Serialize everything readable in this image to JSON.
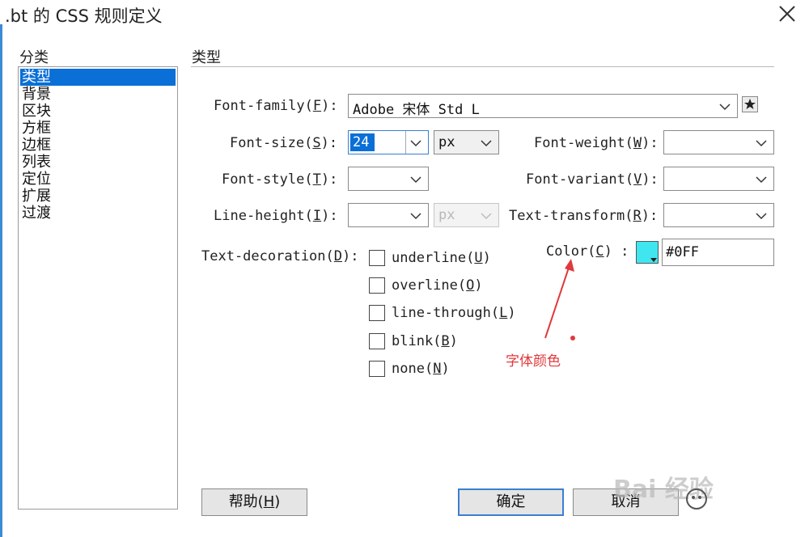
{
  "window": {
    "title": ".bt 的 CSS 规则定义"
  },
  "sidebar": {
    "header": "分类",
    "items": [
      {
        "label": "类型",
        "selected": true
      },
      {
        "label": "背景",
        "selected": false
      },
      {
        "label": "区块",
        "selected": false
      },
      {
        "label": "方框",
        "selected": false
      },
      {
        "label": "边框",
        "selected": false
      },
      {
        "label": "列表",
        "selected": false
      },
      {
        "label": "定位",
        "selected": false
      },
      {
        "label": "扩展",
        "selected": false
      },
      {
        "label": "过渡",
        "selected": false
      }
    ]
  },
  "panel": {
    "header": "类型",
    "font_family": {
      "label_pre": "Font-family(",
      "key": "F",
      "label_post": "):",
      "value": "Adobe 宋体 Std L",
      "icon": "star-icon"
    },
    "font_size": {
      "label_pre": "Font-size(",
      "key": "S",
      "label_post": "):",
      "value": "24",
      "unit": "px"
    },
    "font_weight": {
      "label_pre": "Font-weight(",
      "key": "W",
      "label_post": "):",
      "value": ""
    },
    "font_style": {
      "label_pre": "Font-style(",
      "key": "T",
      "label_post": "):",
      "value": ""
    },
    "font_variant": {
      "label_pre": "Font-variant(",
      "key": "V",
      "label_post": "):",
      "value": ""
    },
    "line_height": {
      "label_pre": "Line-height(",
      "key": "I",
      "label_post": "):",
      "value": "",
      "unit": "px"
    },
    "text_transform": {
      "label_pre": "Text-transform(",
      "key": "R",
      "label_post": "):",
      "value": ""
    },
    "text_decoration": {
      "label_pre": "Text-decoration(",
      "key": "D",
      "label_post": "):",
      "options": [
        {
          "pre": "underline(",
          "key": "U",
          "post": ")",
          "checked": false
        },
        {
          "pre": "overline(",
          "key": "O",
          "post": ")",
          "checked": false
        },
        {
          "pre": "line-through(",
          "key": "L",
          "post": ")",
          "checked": false
        },
        {
          "pre": "blink(",
          "key": "B",
          "post": ")",
          "checked": false
        },
        {
          "pre": "none(",
          "key": "N",
          "post": ")",
          "checked": false
        }
      ]
    },
    "color": {
      "label_pre": "Color(",
      "key": "C",
      "label_post": ") :",
      "value": "#0FF",
      "swatch": "#3fe6f0"
    }
  },
  "annotation": {
    "text": "字体颜色",
    "color": "#e0393b"
  },
  "buttons": {
    "help": {
      "pre": "帮助(",
      "key": "H",
      "post": ")"
    },
    "ok": "确定",
    "cancel": "取消"
  },
  "watermark": {
    "text": "Bai 经验"
  }
}
